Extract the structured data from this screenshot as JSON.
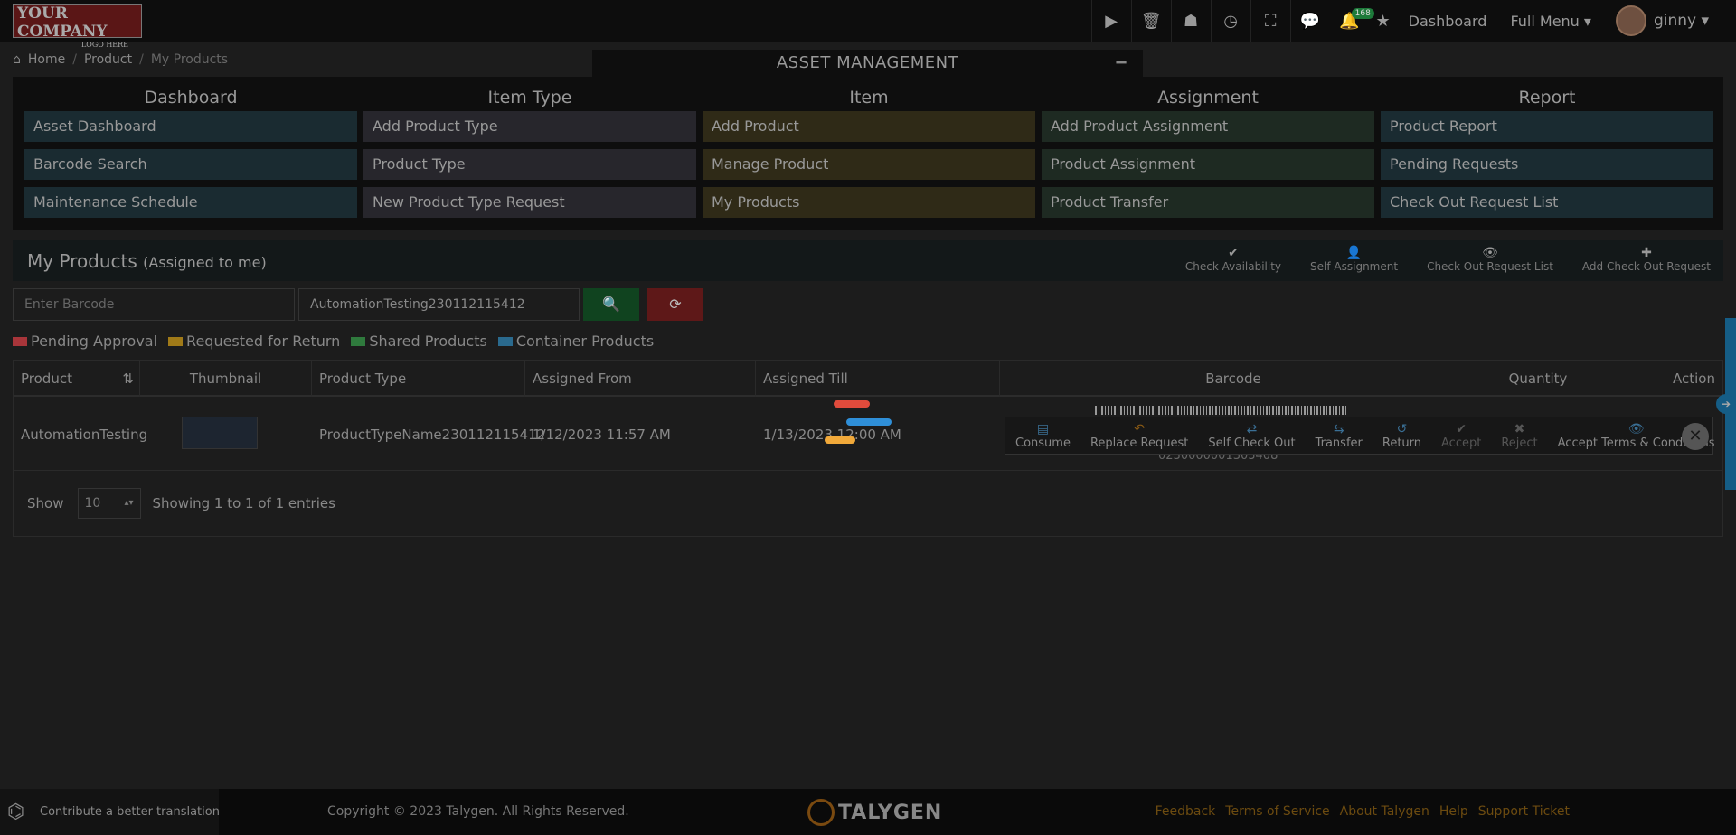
{
  "topbar": {
    "logo_line1": "YOUR COMPANY",
    "logo_line2": "LOGO HERE",
    "notification_count": "168",
    "dashboard_label": "Dashboard",
    "full_menu_label": "Full Menu",
    "user_name": "ginny"
  },
  "breadcrumb": {
    "home": "Home",
    "product": "Product",
    "current": "My Products"
  },
  "asset_panel": {
    "title": "ASSET MANAGEMENT",
    "columns": [
      {
        "title": "Dashboard",
        "items": [
          "Asset Dashboard",
          "Barcode Search",
          "Maintenance Schedule"
        ]
      },
      {
        "title": "Item Type",
        "items": [
          "Add Product Type",
          "Product Type",
          "New Product Type Request"
        ]
      },
      {
        "title": "Item",
        "items": [
          "Add Product",
          "Manage Product",
          "My Products"
        ]
      },
      {
        "title": "Assignment",
        "items": [
          "Add Product Assignment",
          "Product Assignment",
          "Product Transfer"
        ]
      },
      {
        "title": "Report",
        "items": [
          "Product Report",
          "Pending Requests",
          "Check Out Request List"
        ]
      }
    ]
  },
  "my_products": {
    "title": "My Products",
    "subtitle": "(Assigned to me)",
    "actions": [
      "Check Availability",
      "Self Assignment",
      "Check Out Request List",
      "Add Check Out Request"
    ]
  },
  "search": {
    "barcode_placeholder": "Enter Barcode",
    "product_value": "AutomationTesting230112115412"
  },
  "legend": [
    {
      "label": "Pending Approval",
      "color": "#a8353a"
    },
    {
      "label": "Requested for Return",
      "color": "#a07a18"
    },
    {
      "label": "Shared Products",
      "color": "#2f7a3d"
    },
    {
      "label": "Container Products",
      "color": "#2a6a8e"
    }
  ],
  "table": {
    "headers": [
      "Product",
      "Thumbnail",
      "Product Type",
      "Assigned From",
      "Assigned Till",
      "Barcode",
      "Quantity",
      "Action"
    ],
    "row": {
      "product": "AutomationTesting",
      "product_type": "ProductTypeName230112115412",
      "assigned_from": "1/12/2023 11:57 AM",
      "assigned_till": "1/13/2023 12:00 AM",
      "barcode_number": "0230000001303408"
    },
    "row_actions": [
      {
        "label": "Consume",
        "icon": "document-icon",
        "disabled": false
      },
      {
        "label": "Replace Request",
        "icon": "reply-icon",
        "disabled": false
      },
      {
        "label": "Self Check Out",
        "icon": "exchange-icon",
        "disabled": false
      },
      {
        "label": "Transfer",
        "icon": "transfer-icon",
        "disabled": false
      },
      {
        "label": "Return",
        "icon": "undo-icon",
        "disabled": false
      },
      {
        "label": "Accept",
        "icon": "check-icon",
        "disabled": true
      },
      {
        "label": "Reject",
        "icon": "x-icon",
        "disabled": true
      },
      {
        "label": "Accept Terms & Conditions",
        "icon": "eye-icon",
        "disabled": false
      }
    ]
  },
  "pagination": {
    "show_label": "Show",
    "page_size": "10",
    "summary": "Showing 1 to 1 of 1 entries"
  },
  "footer": {
    "translate": "Contribute a better translation",
    "copyright": "Copyright © 2023 Talygen. All Rights Reserved.",
    "brand": "TALYGEN",
    "links": [
      "Feedback",
      "Terms of Service",
      "About Talygen",
      "Help",
      "Support Ticket"
    ]
  }
}
